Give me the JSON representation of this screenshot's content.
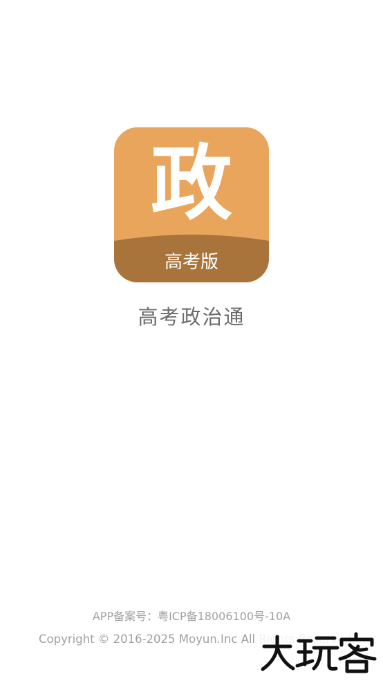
{
  "splash": {
    "icon": {
      "character": "政",
      "edition_label": "高考版",
      "bg_color": "#eaa55c",
      "band_color": "#a8743b"
    },
    "app_name": "高考政治通",
    "footer": {
      "icp": "APP备案号：粤ICP备18006100号-10A",
      "copyright": "Copyright © 2016-2025 Moyun.Inc All Rights Reserved"
    },
    "watermark_text": "大玩客"
  }
}
